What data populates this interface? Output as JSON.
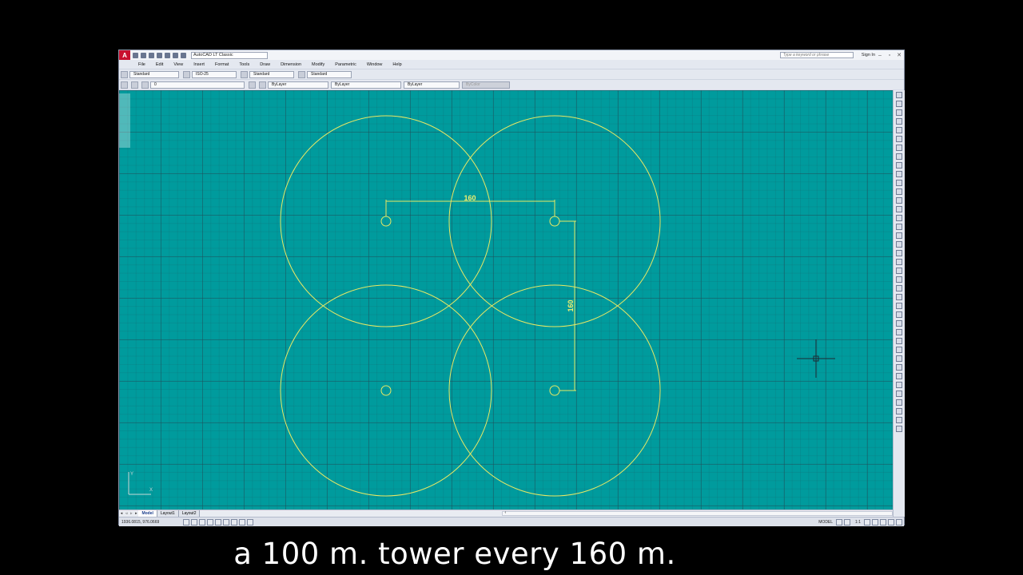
{
  "window": {
    "title": "AutoCAD LT Classic",
    "search_placeholder": "Type a keyword or phrase",
    "sign_in": "Sign In",
    "app_logo": "A"
  },
  "menu": [
    "File",
    "Edit",
    "View",
    "Insert",
    "Format",
    "Tools",
    "Draw",
    "Dimension",
    "Modify",
    "Parametric",
    "Window",
    "Help"
  ],
  "styles_toolbar": {
    "text_style": "Standard",
    "dim_style": "ISO-25",
    "table_style": "Standard",
    "mleader_style": "Standard"
  },
  "layers_toolbar": {
    "layer": "0",
    "color": "ByLayer",
    "linetype": "ByLayer",
    "lineweight": "ByLayer",
    "plotstyle": "ByColor"
  },
  "drawing": {
    "dimension_horizontal": "160",
    "dimension_vertical": "160",
    "ucs_y": "Y",
    "ucs_x": "X",
    "stroke_color": "#e8e864",
    "background_color": "#009b9d"
  },
  "layout_tabs": [
    "Model",
    "Layout1",
    "Layout2"
  ],
  "status": {
    "coordinates": "1936.0815, 976.0669",
    "model": "MODEL",
    "annotation_scale": "1:1"
  },
  "caption": "a 100 m. tower every 160 m."
}
